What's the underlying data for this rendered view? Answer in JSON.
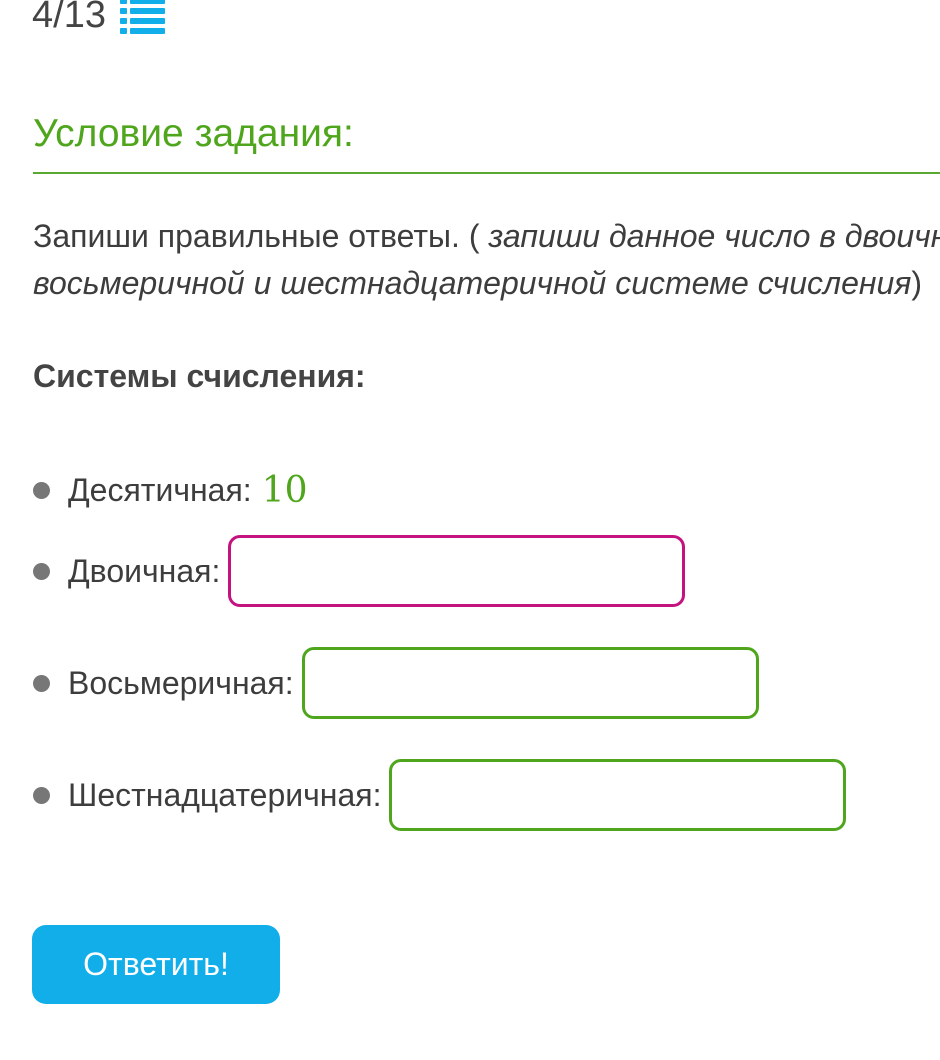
{
  "header": {
    "counter": "4/13",
    "list_icon": "list-icon"
  },
  "condition": {
    "title": "Условие задания:",
    "text_prefix": "Запиши правильные ответы. ( ",
    "text_italic_line1": "запиши данное число в двоично",
    "text_italic_line2": "восьмеричной и шестнадцатеричной системе счисления",
    "text_suffix": ")"
  },
  "systems": {
    "heading": "Системы счисления:",
    "decimal": {
      "label": "Десятичная:",
      "value": "10"
    },
    "binary": {
      "label": "Двоичная:",
      "value": ""
    },
    "octal": {
      "label": "Восьмеричная:",
      "value": ""
    },
    "hex": {
      "label": "Шестнадцатеричная:",
      "value": ""
    }
  },
  "colors": {
    "accent_green": "#4fa61d",
    "active_border": "#c4127f",
    "button_blue": "#12aeea"
  },
  "submit": {
    "label": "Ответить!"
  }
}
